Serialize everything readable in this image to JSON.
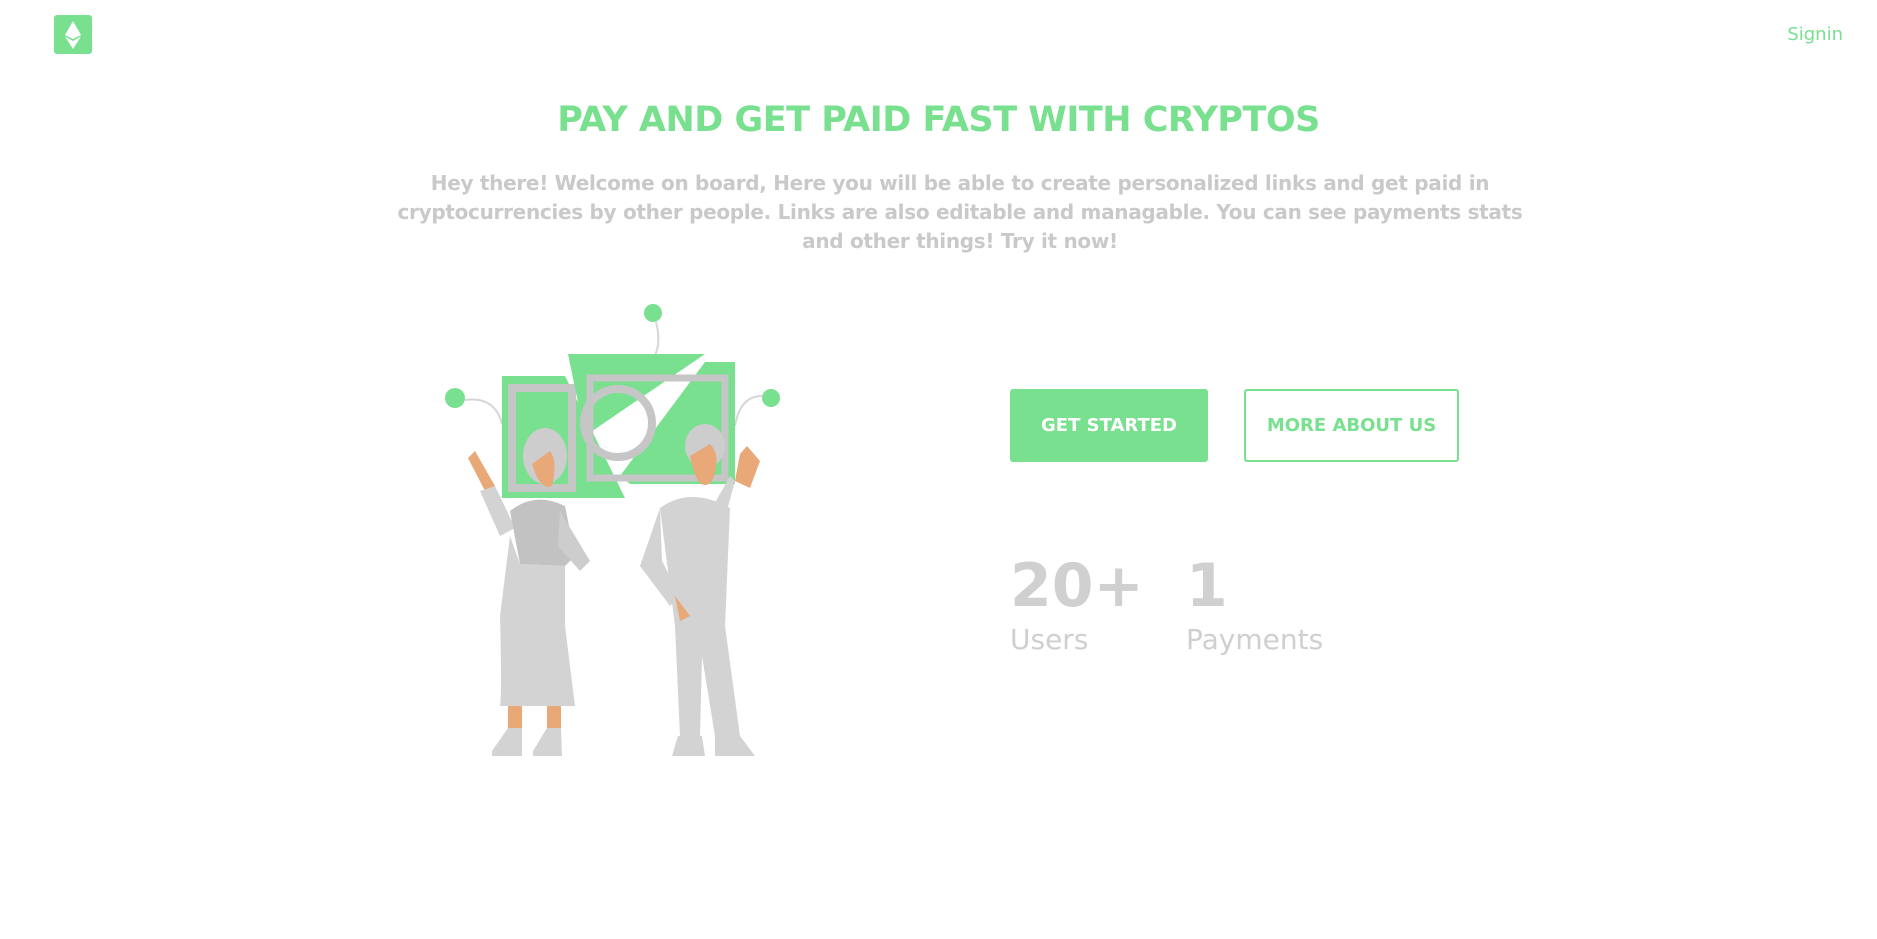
{
  "header": {
    "logo_icon": "ethereum-icon",
    "signin_label": "Signin"
  },
  "hero": {
    "title": "PAY AND GET PAID FAST WITH CRYPTOS",
    "subtitle": "Hey there! Welcome on board, Here you will be able to create personalized links and get paid in cryptocurrencies by other people. Links are also editable and managable. You can see payments stats and other things! Try it now!"
  },
  "actions": {
    "get_started_label": "GET STARTED",
    "more_about_label": "MORE ABOUT US"
  },
  "stats": {
    "users": {
      "value": "20+",
      "label": "Users"
    },
    "payments": {
      "value": "1",
      "label": "Payments"
    }
  },
  "colors": {
    "accent": "#78e08f",
    "muted_text": "#c9c9c9",
    "figure_gray": "#d3d3d3",
    "skin": "#e8a878"
  }
}
